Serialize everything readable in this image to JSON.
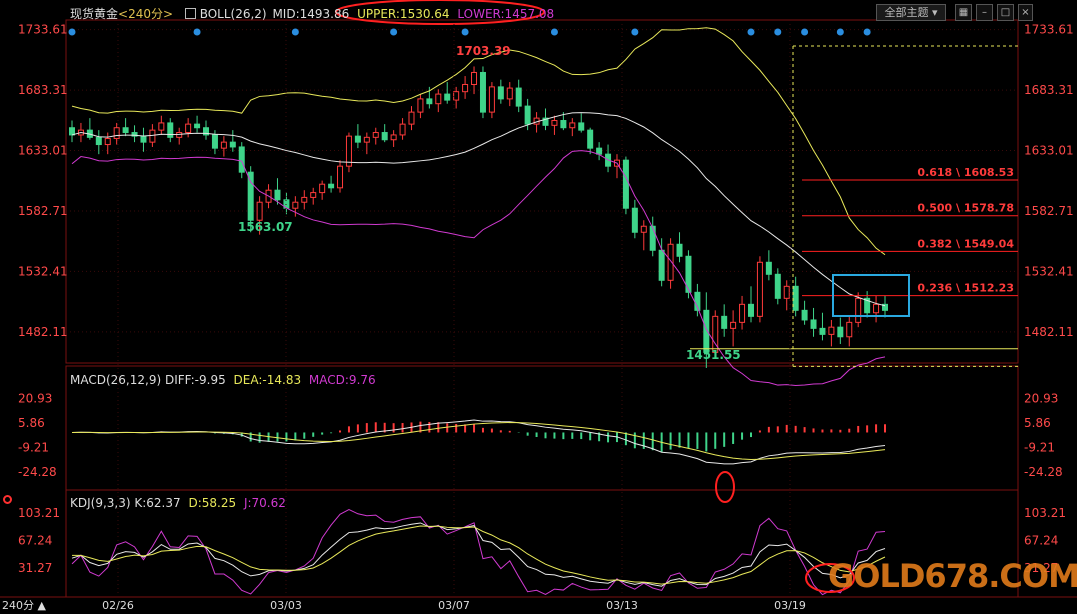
{
  "header": {
    "instrument": "现货黄金",
    "period": "<240分>",
    "boll_label": "BOLL(26,2)",
    "mid": "MID:1493.86",
    "upper": "UPPER:1530.64",
    "lower": "LOWER:1457.08",
    "theme_button": "全部主题",
    "period_tab": "240分",
    "toolbar_icons": [
      "grid-icon",
      "minus-icon",
      "restore-icon",
      "close-icon"
    ]
  },
  "macd_header": {
    "label": "MACD(26,12,9)",
    "diff": "DIFF:-9.95",
    "dea": "DEA:-14.83",
    "macd": "MACD:9.76"
  },
  "kdj_header": {
    "label": "KDJ(9,3,3)",
    "k": "K:62.37",
    "d": "D:58.25",
    "j": "J:70.62"
  },
  "watermark": "GOLD678.COM",
  "colors": {
    "up": "#ff3b3b",
    "down": "#3fd48a",
    "mid_line": "#e8e8e8",
    "upper_line": "#e8e85a",
    "lower_line": "#d03ad0",
    "axis_text": "#ff4a4a",
    "annotation_red": "#ff2020",
    "box_blue": "#2aa9e0",
    "fib_text": "#ff3b3b"
  },
  "chart_data": [
    {
      "type": "candlestick",
      "title": "现货黄金 240分 BOLL(26,2)",
      "x_tick_labels": [
        "02/26",
        "03/03",
        "03/07",
        "03/13",
        "03/19"
      ],
      "y_tick_labels": [
        "1733.61",
        "1683.31",
        "1633.01",
        "1582.71",
        "1532.41",
        "1482.11"
      ],
      "ylim": [
        1457,
        1745
      ],
      "annotations": [
        {
          "label": "1703.39",
          "kind": "high"
        },
        {
          "label": "1563.07",
          "kind": "low"
        },
        {
          "label": "1451.55",
          "kind": "low"
        }
      ],
      "fibonacci": [
        {
          "label": "0.618 \\ 1608.53",
          "value": 1608.53
        },
        {
          "label": "0.500 \\ 1578.78",
          "value": 1578.78
        },
        {
          "label": "0.382 \\ 1549.04",
          "value": 1549.04
        },
        {
          "label": "0.236 \\ 1512.23",
          "value": 1512.23
        }
      ],
      "support_line": 1468,
      "candles_ohlc": [
        [
          1652,
          1658,
          1640,
          1646
        ],
        [
          1646,
          1656,
          1640,
          1650
        ],
        [
          1650,
          1660,
          1642,
          1644
        ],
        [
          1644,
          1650,
          1630,
          1638
        ],
        [
          1638,
          1648,
          1630,
          1643
        ],
        [
          1643,
          1656,
          1638,
          1652
        ],
        [
          1652,
          1660,
          1645,
          1648
        ],
        [
          1648,
          1654,
          1640,
          1645
        ],
        [
          1645,
          1652,
          1632,
          1640
        ],
        [
          1640,
          1655,
          1636,
          1650
        ],
        [
          1650,
          1662,
          1646,
          1656
        ],
        [
          1656,
          1660,
          1640,
          1644
        ],
        [
          1644,
          1652,
          1638,
          1648
        ],
        [
          1648,
          1660,
          1644,
          1655
        ],
        [
          1655,
          1662,
          1648,
          1652
        ],
        [
          1652,
          1658,
          1642,
          1646
        ],
        [
          1646,
          1650,
          1630,
          1635
        ],
        [
          1635,
          1645,
          1628,
          1640
        ],
        [
          1640,
          1650,
          1632,
          1636
        ],
        [
          1636,
          1640,
          1610,
          1615
        ],
        [
          1615,
          1620,
          1565,
          1575
        ],
        [
          1575,
          1595,
          1563,
          1590
        ],
        [
          1590,
          1605,
          1585,
          1600
        ],
        [
          1600,
          1610,
          1588,
          1592
        ],
        [
          1592,
          1598,
          1580,
          1585
        ],
        [
          1585,
          1595,
          1578,
          1590
        ],
        [
          1590,
          1600,
          1584,
          1594
        ],
        [
          1594,
          1602,
          1588,
          1598
        ],
        [
          1598,
          1608,
          1592,
          1605
        ],
        [
          1605,
          1612,
          1598,
          1602
        ],
        [
          1602,
          1625,
          1598,
          1620
        ],
        [
          1620,
          1648,
          1615,
          1645
        ],
        [
          1645,
          1655,
          1635,
          1640
        ],
        [
          1640,
          1648,
          1630,
          1644
        ],
        [
          1644,
          1652,
          1638,
          1648
        ],
        [
          1648,
          1655,
          1640,
          1642
        ],
        [
          1642,
          1650,
          1636,
          1646
        ],
        [
          1646,
          1660,
          1642,
          1655
        ],
        [
          1655,
          1670,
          1650,
          1665
        ],
        [
          1665,
          1680,
          1660,
          1676
        ],
        [
          1676,
          1686,
          1668,
          1672
        ],
        [
          1672,
          1684,
          1665,
          1680
        ],
        [
          1680,
          1690,
          1672,
          1675
        ],
        [
          1675,
          1686,
          1668,
          1682
        ],
        [
          1682,
          1695,
          1676,
          1688
        ],
        [
          1688,
          1703,
          1680,
          1698
        ],
        [
          1698,
          1703,
          1660,
          1665
        ],
        [
          1665,
          1690,
          1660,
          1686
        ],
        [
          1686,
          1692,
          1672,
          1676
        ],
        [
          1676,
          1690,
          1670,
          1685
        ],
        [
          1685,
          1692,
          1665,
          1670
        ],
        [
          1670,
          1676,
          1650,
          1655
        ],
        [
          1655,
          1665,
          1648,
          1660
        ],
        [
          1660,
          1668,
          1650,
          1654
        ],
        [
          1654,
          1662,
          1646,
          1658
        ],
        [
          1658,
          1665,
          1650,
          1652
        ],
        [
          1652,
          1660,
          1645,
          1656
        ],
        [
          1656,
          1664,
          1648,
          1650
        ],
        [
          1650,
          1652,
          1630,
          1635
        ],
        [
          1635,
          1640,
          1625,
          1630
        ],
        [
          1630,
          1638,
          1615,
          1620
        ],
        [
          1620,
          1630,
          1610,
          1625
        ],
        [
          1625,
          1628,
          1580,
          1585
        ],
        [
          1585,
          1592,
          1560,
          1565
        ],
        [
          1565,
          1575,
          1550,
          1570
        ],
        [
          1570,
          1578,
          1545,
          1550
        ],
        [
          1550,
          1560,
          1520,
          1525
        ],
        [
          1525,
          1560,
          1518,
          1555
        ],
        [
          1555,
          1565,
          1540,
          1545
        ],
        [
          1545,
          1550,
          1510,
          1515
        ],
        [
          1515,
          1522,
          1495,
          1500
        ],
        [
          1500,
          1515,
          1452,
          1465
        ],
        [
          1465,
          1500,
          1460,
          1495
        ],
        [
          1495,
          1505,
          1478,
          1485
        ],
        [
          1485,
          1500,
          1470,
          1490
        ],
        [
          1490,
          1512,
          1484,
          1505
        ],
        [
          1505,
          1520,
          1490,
          1495
        ],
        [
          1495,
          1545,
          1490,
          1540
        ],
        [
          1540,
          1550,
          1525,
          1530
        ],
        [
          1530,
          1535,
          1505,
          1510
        ],
        [
          1510,
          1525,
          1500,
          1520
        ],
        [
          1520,
          1528,
          1495,
          1500
        ],
        [
          1500,
          1508,
          1488,
          1492
        ],
        [
          1492,
          1502,
          1478,
          1485
        ],
        [
          1485,
          1498,
          1475,
          1480
        ],
        [
          1480,
          1492,
          1470,
          1486
        ],
        [
          1486,
          1494,
          1472,
          1478
        ],
        [
          1478,
          1495,
          1470,
          1490
        ],
        [
          1490,
          1515,
          1486,
          1510
        ],
        [
          1510,
          1516,
          1494,
          1498
        ],
        [
          1498,
          1512,
          1490,
          1505
        ],
        [
          1505,
          1512,
          1494,
          1500
        ]
      ]
    },
    {
      "type": "macd",
      "y_tick_labels": [
        "20.93",
        "5.86",
        "-9.21",
        "-24.28"
      ],
      "series": [
        {
          "name": "DIFF"
        },
        {
          "name": "DEA"
        },
        {
          "name": "MACD"
        }
      ]
    },
    {
      "type": "kdj",
      "y_tick_labels": [
        "103.21",
        "67.24",
        "31.27"
      ],
      "series": [
        {
          "name": "K"
        },
        {
          "name": "D"
        },
        {
          "name": "J"
        }
      ]
    }
  ]
}
